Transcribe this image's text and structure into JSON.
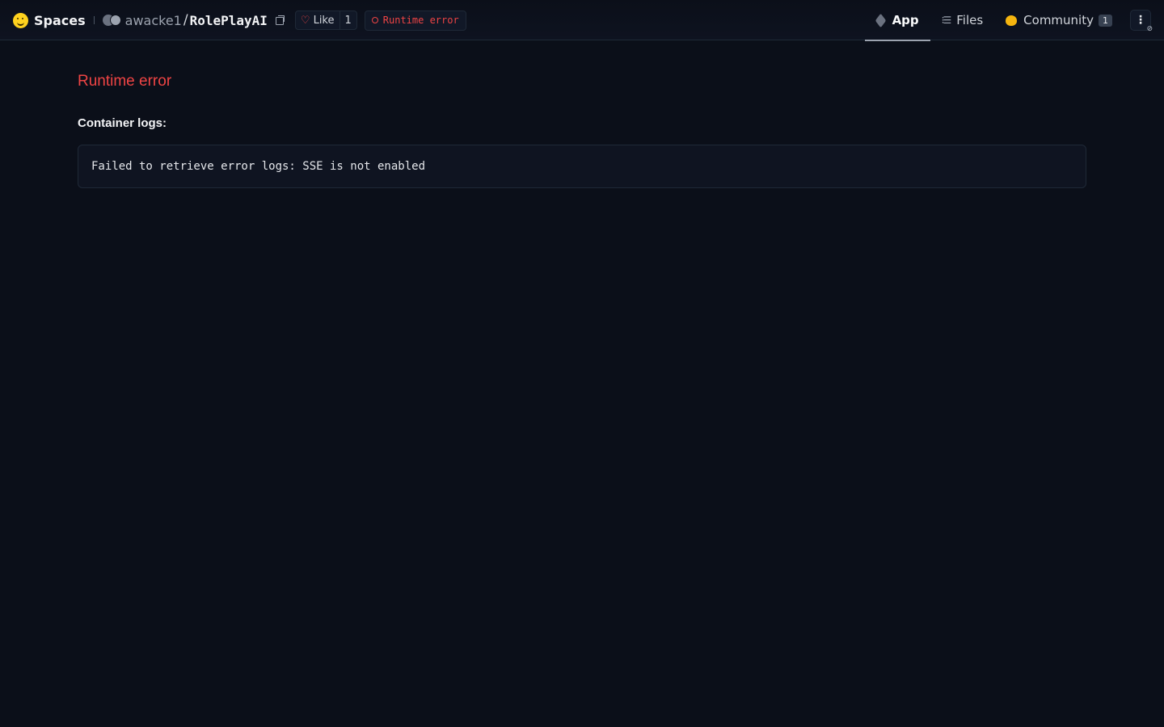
{
  "header": {
    "brand": "Spaces",
    "owner": "awacke1",
    "separator": "/",
    "repo": "RolePlayAI",
    "like_label": "Like",
    "like_count": "1",
    "status": "Runtime error"
  },
  "tabs": [
    {
      "label": "App",
      "icon": "cube-icon",
      "active": true
    },
    {
      "label": "Files",
      "icon": "files-icon"
    },
    {
      "label": "Community",
      "icon": "community-icon",
      "badge": "1"
    }
  ],
  "main": {
    "error_title": "Runtime error",
    "logs_label": "Container logs:",
    "log_text": "Failed to retrieve error logs: SSE is not enabled"
  },
  "colors": {
    "background": "#0b0f19",
    "error": "#ef4444",
    "accent": "#ffd21e"
  }
}
